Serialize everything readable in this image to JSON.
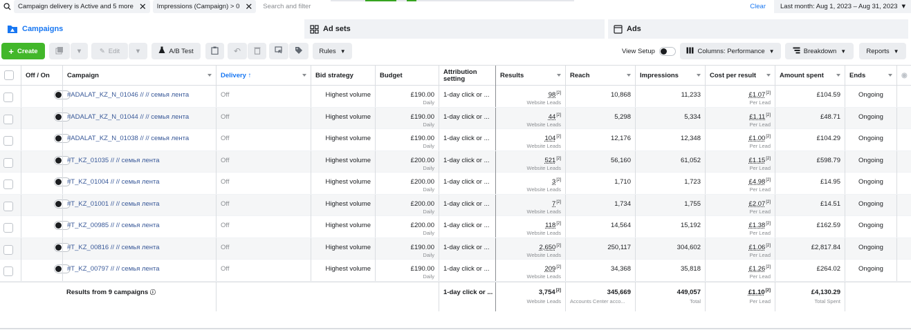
{
  "filters": {
    "chips": [
      "Campaign delivery is Active and 5 more",
      "Impressions (Campaign) > 0"
    ],
    "search_placeholder": "Search and filter",
    "clear_label": "Clear",
    "date_range": "Last month: Aug 1, 2023 – Aug 31, 2023"
  },
  "tabs": [
    {
      "label": "Campaigns",
      "active": true
    },
    {
      "label": "Ad sets"
    },
    {
      "label": "Ads"
    }
  ],
  "toolbar": {
    "create_label": "Create",
    "edit_label": "Edit",
    "ab_test_label": "A/B Test",
    "rules_label": "Rules",
    "view_setup_label": "View Setup",
    "columns_label": "Columns: Performance",
    "breakdown_label": "Breakdown",
    "reports_label": "Reports"
  },
  "colors": {
    "accent": "#1877f2",
    "create": "#42b72a",
    "link": "#385898"
  },
  "table": {
    "headers": {
      "off_on": "Off / On",
      "campaign": "Campaign",
      "delivery": "Delivery ↑",
      "bid_strategy": "Bid strategy",
      "budget": "Budget",
      "attribution": "Attribution setting",
      "results": "Results",
      "reach": "Reach",
      "impressions": "Impressions",
      "cost_per_result": "Cost per result",
      "amount_spent": "Amount spent",
      "ends": "Ends"
    },
    "rows": [
      {
        "campaign": "#ADALAT_KZ_N_01046 // // семья лента",
        "delivery": "Off",
        "bid": "Highest volume",
        "budget": "£190.00",
        "budget_sub": "Daily",
        "attribution": "1-day click or ...",
        "results": "98",
        "results_sub": "Website Leads",
        "reach": "10,868",
        "impressions": "11,233",
        "cpr": "£1.07",
        "cpr_sub": "Per Lead",
        "spent": "£104.59",
        "ends": "Ongoing"
      },
      {
        "campaign": "#ADALAT_KZ_N_01044 // // семья лента",
        "delivery": "Off",
        "bid": "Highest volume",
        "budget": "£190.00",
        "budget_sub": "Daily",
        "attribution": "1-day click or ...",
        "results": "44",
        "results_sub": "Website Leads",
        "reach": "5,298",
        "impressions": "5,334",
        "cpr": "£1.11",
        "cpr_sub": "Per Lead",
        "spent": "£48.71",
        "ends": "Ongoing"
      },
      {
        "campaign": "#ADALAT_KZ_N_01038 // // семья лента",
        "delivery": "Off",
        "bid": "Highest volume",
        "budget": "£190.00",
        "budget_sub": "Daily",
        "attribution": "1-day click or ...",
        "results": "104",
        "results_sub": "Website Leads",
        "reach": "12,176",
        "impressions": "12,348",
        "cpr": "£1.00",
        "cpr_sub": "Per Lead",
        "spent": "£104.29",
        "ends": "Ongoing"
      },
      {
        "campaign": "#T_KZ_01035 // // семья лента",
        "delivery": "Off",
        "bid": "Highest volume",
        "budget": "£200.00",
        "budget_sub": "Daily",
        "attribution": "1-day click or ...",
        "results": "521",
        "results_sub": "Website Leads",
        "reach": "56,160",
        "impressions": "61,052",
        "cpr": "£1.15",
        "cpr_sub": "Per Lead",
        "spent": "£598.79",
        "ends": "Ongoing"
      },
      {
        "campaign": "#T_KZ_01004 // // семья лента",
        "delivery": "Off",
        "bid": "Highest volume",
        "budget": "£200.00",
        "budget_sub": "Daily",
        "attribution": "1-day click or ...",
        "results": "3",
        "results_sub": "Website Leads",
        "reach": "1,710",
        "impressions": "1,723",
        "cpr": "£4.98",
        "cpr_sub": "Per Lead",
        "spent": "£14.95",
        "ends": "Ongoing"
      },
      {
        "campaign": "#T_KZ_01001 // // семья лента",
        "delivery": "Off",
        "bid": "Highest volume",
        "budget": "£200.00",
        "budget_sub": "Daily",
        "attribution": "1-day click or ...",
        "results": "7",
        "results_sub": "Website Leads",
        "reach": "1,734",
        "impressions": "1,755",
        "cpr": "£2.07",
        "cpr_sub": "Per Lead",
        "spent": "£14.51",
        "ends": "Ongoing"
      },
      {
        "campaign": "#T_KZ_00985 // // семья лента",
        "delivery": "Off",
        "bid": "Highest volume",
        "budget": "£200.00",
        "budget_sub": "Daily",
        "attribution": "1-day click or ...",
        "results": "118",
        "results_sub": "Website Leads",
        "reach": "14,564",
        "impressions": "15,192",
        "cpr": "£1.38",
        "cpr_sub": "Per Lead",
        "spent": "£162.59",
        "ends": "Ongoing"
      },
      {
        "campaign": "#T_KZ_00816 // // семья лента",
        "delivery": "Off",
        "bid": "Highest volume",
        "budget": "£190.00",
        "budget_sub": "Daily",
        "attribution": "1-day click or ...",
        "results": "2,650",
        "results_sub": "Website Leads",
        "reach": "250,117",
        "impressions": "304,602",
        "cpr": "£1.06",
        "cpr_sub": "Per Lead",
        "spent": "£2,817.84",
        "ends": "Ongoing"
      },
      {
        "campaign": "#T_KZ_00797 // // семья лента",
        "delivery": "Off",
        "bid": "Highest volume",
        "budget": "£190.00",
        "budget_sub": "Daily",
        "attribution": "1-day click or ...",
        "results": "209",
        "results_sub": "Website Leads",
        "reach": "34,368",
        "impressions": "35,818",
        "cpr": "£1.26",
        "cpr_sub": "Per Lead",
        "spent": "£264.02",
        "ends": "Ongoing"
      }
    ],
    "footer": {
      "label": "Results from 9 campaigns",
      "attribution": "1-day click or ...",
      "results": "3,754",
      "results_sub": "Website Leads",
      "reach": "345,669",
      "reach_sub": "Accounts Center acco...",
      "impressions": "449,057",
      "impressions_sub": "Total",
      "cpr": "£1.10",
      "cpr_sub": "Per Lead",
      "spent": "£4,130.29",
      "spent_sub": "Total Spent"
    }
  }
}
